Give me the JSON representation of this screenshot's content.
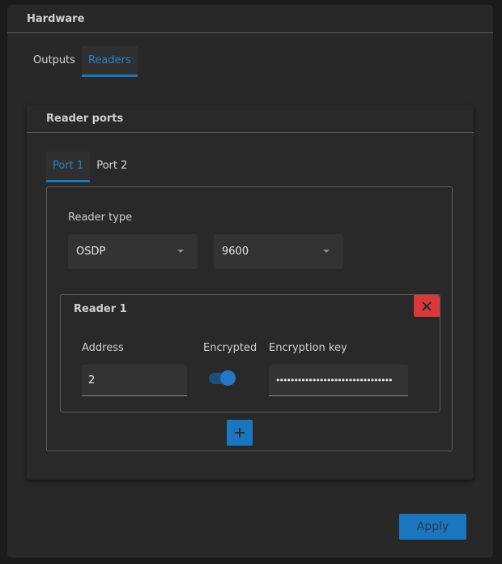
{
  "header": {
    "title": "Hardware"
  },
  "main_tabs": [
    {
      "label": "Outputs",
      "active": false
    },
    {
      "label": "Readers",
      "active": true
    }
  ],
  "reader_ports": {
    "title": "Reader ports",
    "port_tabs": [
      {
        "label": "Port 1",
        "active": true
      },
      {
        "label": "Port 2",
        "active": false
      }
    ],
    "reader_type": {
      "label": "Reader type",
      "type_value": "OSDP",
      "baud_value": "9600"
    },
    "readers": [
      {
        "title": "Reader 1",
        "address_label": "Address",
        "address_value": "2",
        "encrypted_label": "Encrypted",
        "encrypted": true,
        "encryption_key_label": "Encryption key",
        "encryption_key_value": "••••••••••••••••••••••••••••••••"
      }
    ],
    "remove_icon": "close-icon",
    "add_icon": "plus-icon"
  },
  "actions": {
    "apply_label": "Apply"
  },
  "colors": {
    "accent": "#1b76c0",
    "danger": "#d9393b",
    "background": "#282828"
  }
}
